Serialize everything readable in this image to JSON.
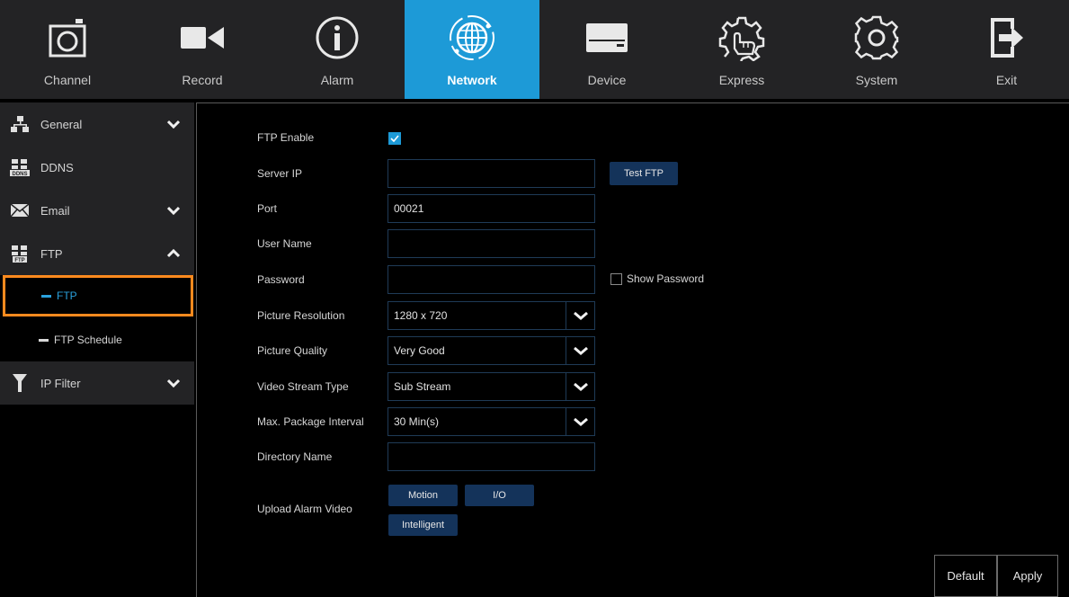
{
  "nav": {
    "tabs": [
      {
        "label": "Channel",
        "icon": "camera-icon"
      },
      {
        "label": "Record",
        "icon": "video-camera-icon"
      },
      {
        "label": "Alarm",
        "icon": "info-icon"
      },
      {
        "label": "Network",
        "icon": "globe-icon",
        "active": true
      },
      {
        "label": "Device",
        "icon": "hard-drive-icon"
      },
      {
        "label": "Express",
        "icon": "gear-hand-icon"
      },
      {
        "label": "System",
        "icon": "gear-icon"
      },
      {
        "label": "Exit",
        "icon": "exit-icon"
      }
    ]
  },
  "sidebar": {
    "groups": [
      {
        "label": "General",
        "icon": "network-icon",
        "chevron": "down"
      },
      {
        "label": "DDNS",
        "icon": "ddns-icon"
      },
      {
        "label": "Email",
        "icon": "envelope-icon",
        "chevron": "down"
      },
      {
        "label": "FTP",
        "icon": "ftp-icon",
        "chevron": "up"
      },
      {
        "label": "IP Filter",
        "icon": "filter-icon",
        "chevron": "down"
      }
    ],
    "subitems": [
      {
        "label": "FTP",
        "active": true
      },
      {
        "label": "FTP Schedule"
      }
    ]
  },
  "form": {
    "ftp_enable": {
      "label": "FTP Enable",
      "checked": true
    },
    "server_ip": {
      "label": "Server IP",
      "value": ""
    },
    "test_ftp_button": "Test FTP",
    "port": {
      "label": "Port",
      "value": "00021"
    },
    "user_name": {
      "label": "User Name",
      "value": ""
    },
    "password": {
      "label": "Password",
      "value": ""
    },
    "show_password": {
      "label": "Show Password",
      "checked": false
    },
    "picture_resolution": {
      "label": "Picture Resolution",
      "value": "1280 x 720"
    },
    "picture_quality": {
      "label": "Picture Quality",
      "value": "Very Good"
    },
    "video_stream_type": {
      "label": "Video Stream Type",
      "value": "Sub Stream"
    },
    "max_package_interval": {
      "label": "Max. Package Interval",
      "value": "30 Min(s)"
    },
    "directory_name": {
      "label": "Directory Name",
      "value": ""
    },
    "upload_alarm_video": {
      "label": "Upload Alarm Video",
      "buttons": [
        "Motion",
        "I/O",
        "Intelligent"
      ]
    }
  },
  "footer": {
    "default_button": "Default",
    "apply_button": "Apply"
  },
  "colors": {
    "accent": "#1d9ad7",
    "topbar_bg": "#232325",
    "field_border": "#1f3b57",
    "button_bg": "#14335a",
    "selection_outline": "#ff8a1e"
  }
}
